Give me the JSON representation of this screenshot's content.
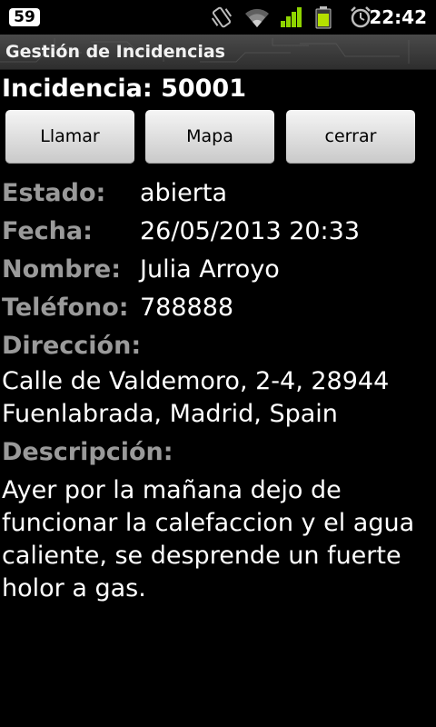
{
  "status_bar": {
    "notification_count": "59",
    "icons": [
      "vibrate-icon",
      "wifi-icon",
      "signal-icon",
      "battery-icon",
      "alarm-icon"
    ],
    "time": "22:42"
  },
  "app": {
    "title": "Gestión de Incidencias"
  },
  "incident": {
    "heading": "Incidencia: 50001",
    "buttons": {
      "call": "Llamar",
      "map": "Mapa",
      "close": "cerrar"
    },
    "fields": {
      "estado_label": "Estado:",
      "estado_value": "abierta",
      "fecha_label": "Fecha:",
      "fecha_value": "26/05/2013 20:33",
      "nombre_label": "Nombre:",
      "nombre_value": "Julia Arroyo",
      "telefono_label": "Teléfono:",
      "telefono_value": "788888",
      "direccion_label": "Dirección:",
      "direccion_value": "Calle de Valdemoro, 2-4, 28944 Fuenlabrada, Madrid, Spain",
      "descripcion_label": "Descripción:",
      "descripcion_value": "Ayer por la mañana dejo de funcionar la calefaccion y el agua caliente, se desprende un fuerte holor a gas."
    }
  },
  "colors": {
    "background": "#000000",
    "label": "#9a9a9a",
    "value": "#ffffff",
    "button": "#e0e0e0",
    "signal": "#8fd400"
  }
}
